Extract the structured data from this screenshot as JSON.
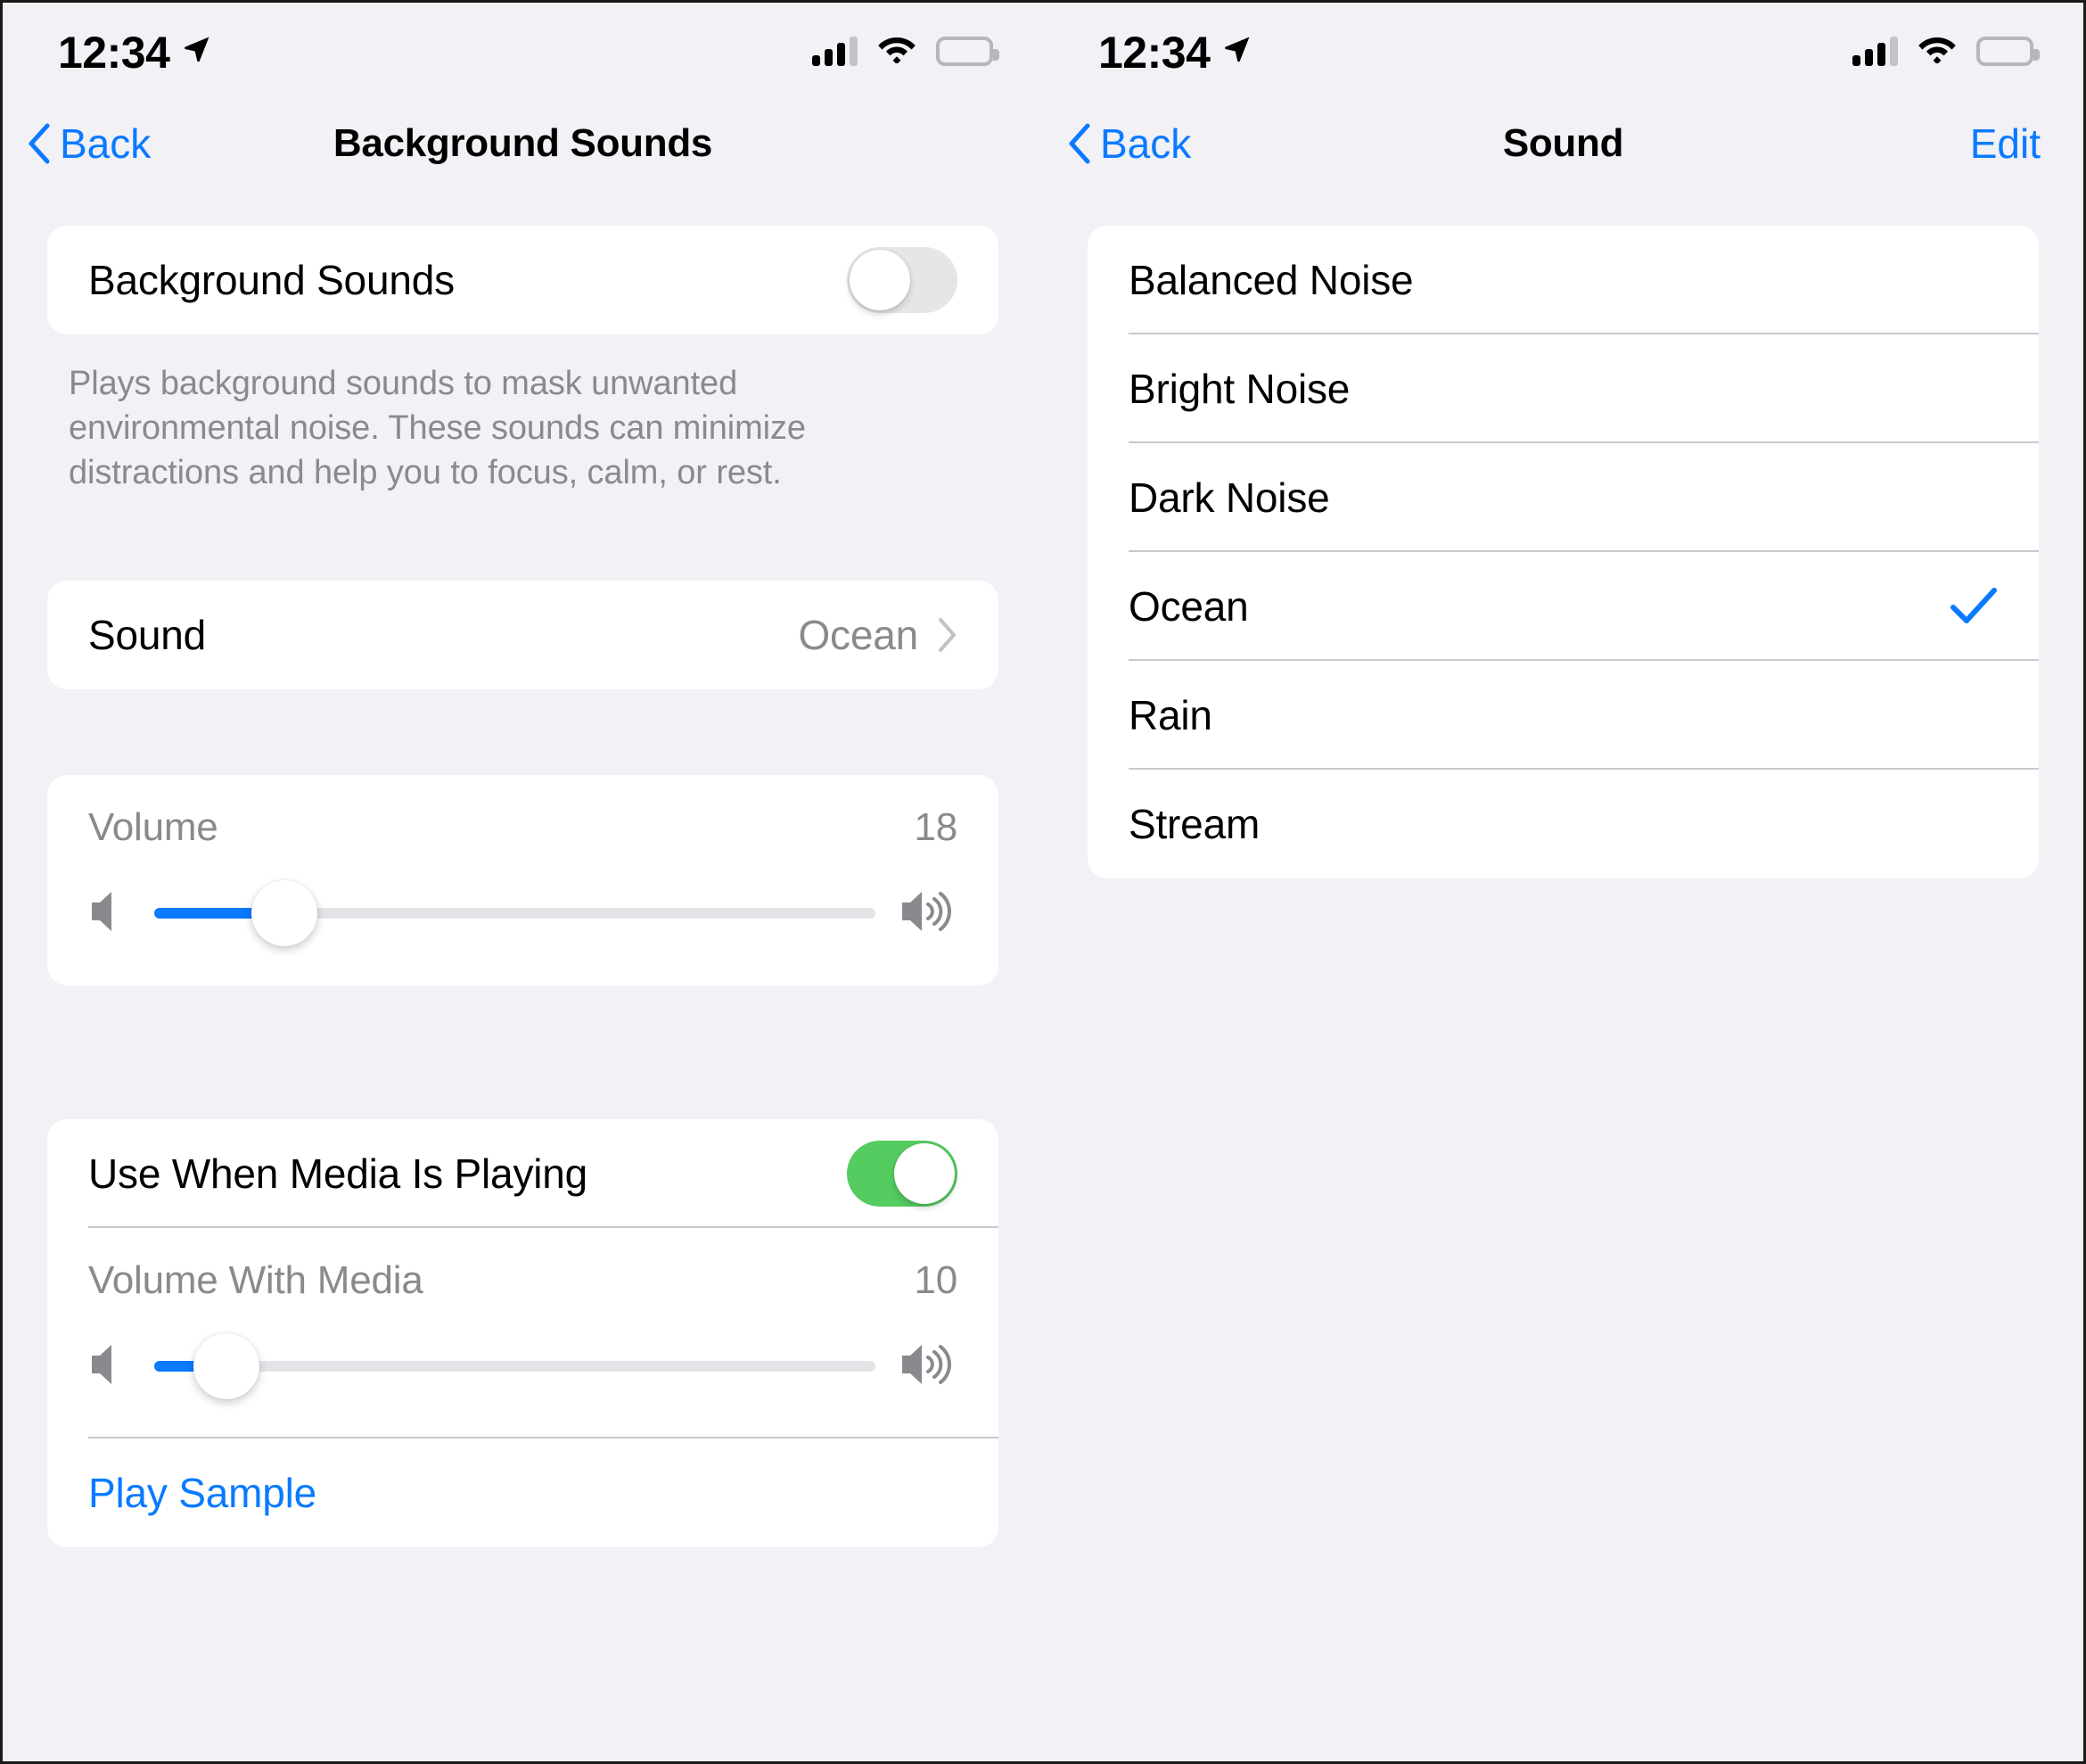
{
  "left_panel": {
    "status_bar": {
      "time": "12:34",
      "location_icon": "location-arrow-icon",
      "cellular_icon": "cellular-signal-icon",
      "wifi_icon": "wifi-icon",
      "battery_icon": "battery-full-icon"
    },
    "nav": {
      "back_label": "Back",
      "title": "Background Sounds"
    },
    "background_sounds_row": {
      "label": "Background Sounds",
      "toggle_state": "off"
    },
    "footnote": "Plays background sounds to mask unwanted environmental noise. These sounds can minimize distractions and help you to focus, calm, or rest.",
    "sound_row": {
      "label": "Sound",
      "value": "Ocean",
      "chevron_icon": "chevron-right-icon"
    },
    "volume_slider": {
      "label": "Volume",
      "value": "18",
      "percent": 18,
      "min_icon": "speaker-low-icon",
      "max_icon": "speaker-high-icon"
    },
    "use_when_media_row": {
      "label": "Use When Media Is Playing",
      "toggle_state": "on"
    },
    "volume_with_media_slider": {
      "label": "Volume With Media",
      "value": "10",
      "percent": 10,
      "min_icon": "speaker-low-icon",
      "max_icon": "speaker-high-icon"
    },
    "play_sample": {
      "label": "Play Sample"
    }
  },
  "right_panel": {
    "status_bar": {
      "time": "12:34",
      "location_icon": "location-arrow-icon",
      "cellular_icon": "cellular-signal-icon",
      "wifi_icon": "wifi-icon",
      "battery_icon": "battery-full-icon"
    },
    "nav": {
      "back_label": "Back",
      "title": "Sound",
      "edit_label": "Edit"
    },
    "sound_list": [
      {
        "label": "Balanced Noise",
        "selected": false
      },
      {
        "label": "Bright Noise",
        "selected": false
      },
      {
        "label": "Dark Noise",
        "selected": false
      },
      {
        "label": "Ocean",
        "selected": true
      },
      {
        "label": "Rain",
        "selected": false
      },
      {
        "label": "Stream",
        "selected": false
      }
    ],
    "checkmark_icon": "checkmark-icon"
  },
  "colors": {
    "accent_blue": "#0a7aff",
    "toggle_on_green": "#55cc60",
    "toggle_off_gray": "#e6e6e8",
    "background": "#f1f1f6",
    "card": "#ffffff",
    "secondary_text": "#8a8a8e"
  }
}
